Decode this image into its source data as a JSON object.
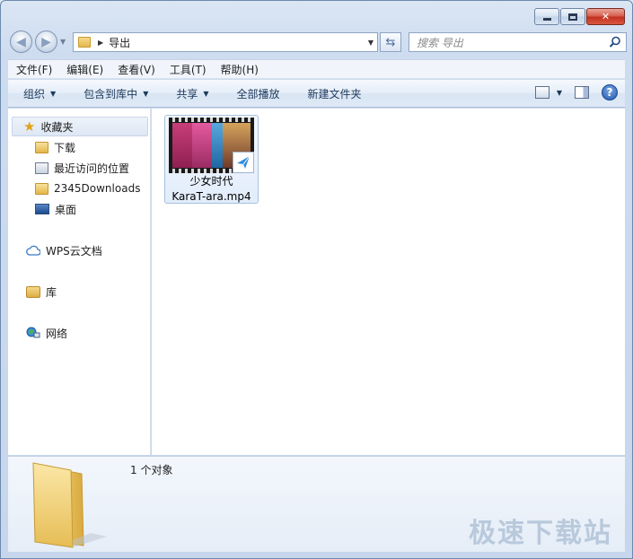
{
  "address": {
    "path": "导出"
  },
  "search": {
    "placeholder": "搜索 导出"
  },
  "menu": [
    "文件(F)",
    "编辑(E)",
    "查看(V)",
    "工具(T)",
    "帮助(H)"
  ],
  "toolbar": {
    "organize": "组织",
    "include_in_library": "包含到库中",
    "share": "共享",
    "play_all": "全部播放",
    "new_folder": "新建文件夹"
  },
  "nav": {
    "favorites": "收藏夹",
    "downloads": "下载",
    "recent": "最近访问的位置",
    "downloads2345": "2345Downloads",
    "desktop": "桌面",
    "wps": "WPS云文档",
    "library": "库",
    "network": "网络"
  },
  "files": [
    {
      "name_line1": "少女时代",
      "name_line2": "KaraT-ara.mp4"
    }
  ],
  "details": {
    "count": "1 个对象"
  },
  "watermark": "极速下载站",
  "colors": {
    "accent": "#1e395b",
    "selection": "#dde7f4"
  }
}
